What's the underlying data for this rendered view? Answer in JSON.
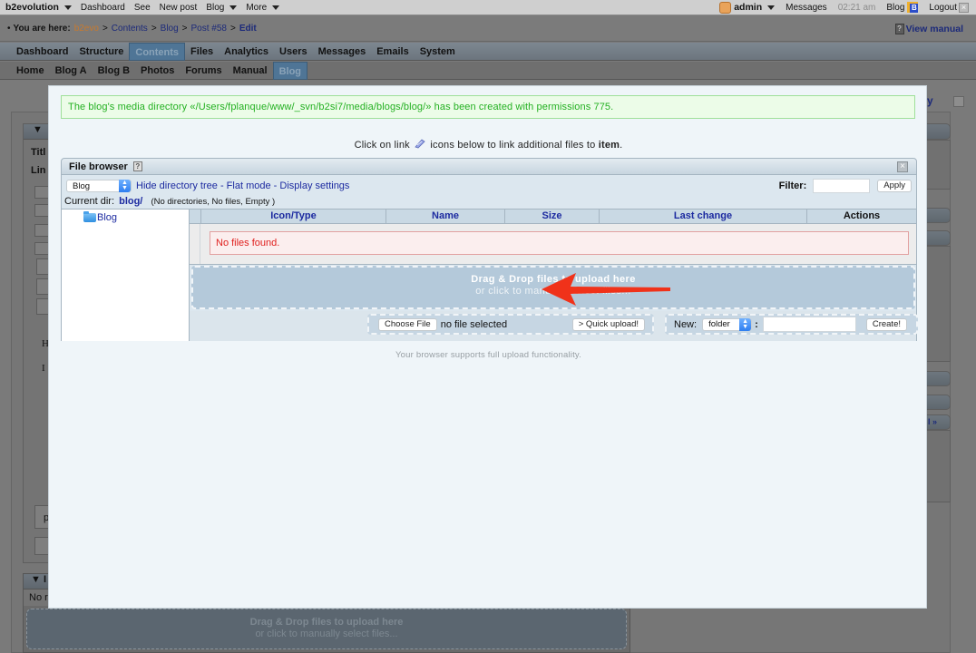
{
  "topbar": {
    "brand": "b2evolution",
    "items": [
      "Dashboard",
      "See",
      "New post",
      "Blog",
      "More"
    ],
    "user": "admin",
    "messages": "Messages",
    "time": "02:21 am",
    "blog": "Blog",
    "logout": "Logout"
  },
  "breadcrumb": {
    "prefix": "You are here:",
    "items": [
      "b2evo",
      "Contents",
      "Blog",
      "Post #58",
      "Edit"
    ],
    "separator": ">",
    "view_manual": "View manual"
  },
  "main_menu": {
    "tabs": [
      "Dashboard",
      "Structure",
      "Contents",
      "Files",
      "Analytics",
      "Users",
      "Messages",
      "Emails",
      "System"
    ],
    "active": "Contents"
  },
  "blog_menu": {
    "tabs": [
      "Home",
      "Blog A",
      "Blog B",
      "Photos",
      "Forums",
      "Manual",
      "Blog"
    ],
    "active": "Blog"
  },
  "background": {
    "title_label": "Titl",
    "link_label": "Lin",
    "text_h": "H",
    "text_i": "I",
    "p_label": "p",
    "no_label": "No r",
    "drop_title": "Drag & Drop files to upload here",
    "drop_sub": "or click to manually select files...",
    "right_link": "y",
    "right_more": "l »"
  },
  "modal": {
    "success_message": "The blog's media directory «/Users/fplanque/www/_svn/b2si7/media/blogs/blog/» has been created with permissions 775.",
    "hint_before": "Click on link",
    "hint_after": "icons below to link additional files to",
    "hint_target": "item",
    "hint_end": ".",
    "file_browser": {
      "title": "File browser",
      "root_select": "Blog",
      "links": [
        "Hide directory tree",
        "Flat mode",
        "Display settings"
      ],
      "filter_label": "Filter:",
      "filter_value": "",
      "apply_label": "Apply",
      "current_dir_label": "Current dir:",
      "current_dir": "blog/",
      "dir_info": "(No directories, No files, Empty )",
      "tree": [
        "Blog"
      ],
      "columns": [
        "Icon/Type",
        "Name",
        "Size",
        "Last change",
        "Actions"
      ],
      "empty_message": "No files found.",
      "drop_title": "Drag & Drop files to upload here",
      "drop_sub": "or click to manually select files...",
      "choose_file_label": "Choose File",
      "no_file_selected": "no file selected",
      "quick_upload_label": "> Quick upload!",
      "new_label": "New:",
      "new_type": "folder",
      "new_name": "",
      "create_label": "Create!"
    },
    "support_note": "Your browser supports full upload functionality."
  },
  "colors": {
    "success_text": "#23b021",
    "error_text": "#e0201e",
    "link": "#1c2aa0",
    "annotation_arrow": "#f0321a"
  }
}
